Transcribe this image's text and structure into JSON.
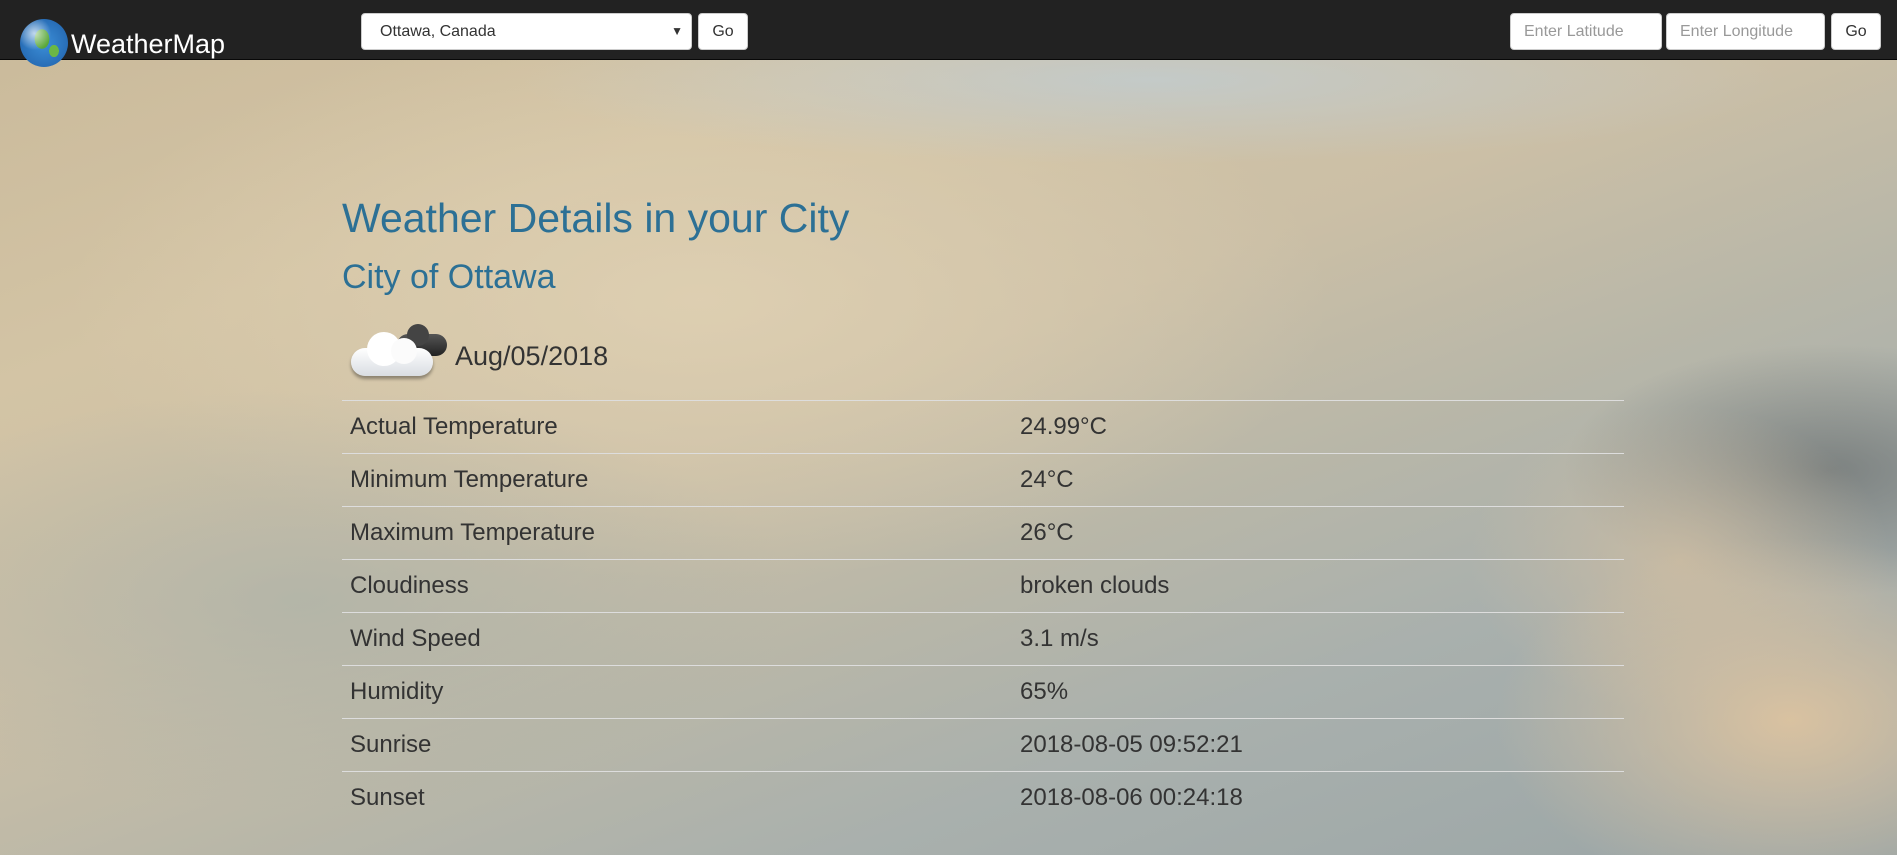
{
  "navbar": {
    "brand_name": "WeatherMap",
    "city_select_value": "Ottawa, Canada",
    "city_go_label": "Go",
    "latitude_placeholder": "Enter Latitude",
    "longitude_placeholder": "Enter Longitude",
    "coord_go_label": "Go",
    "icons": {
      "brand_icon": "globe-icon",
      "select_arrow": "chevron-down-icon"
    }
  },
  "main": {
    "title": "Weather Details in your City",
    "city_name": "City of Ottawa",
    "weather_icon": "broken-clouds-icon",
    "date": "Aug/05/2018",
    "details": [
      {
        "label": "Actual Temperature",
        "value": "24.99°C"
      },
      {
        "label": "Minimum Temperature",
        "value": "24°C"
      },
      {
        "label": "Maximum Temperature",
        "value": "26°C"
      },
      {
        "label": "Cloudiness",
        "value": "broken clouds"
      },
      {
        "label": "Wind Speed",
        "value": "3.1 m/s"
      },
      {
        "label": "Humidity",
        "value": "65%"
      },
      {
        "label": "Sunrise",
        "value": "2018-08-05 09:52:21"
      },
      {
        "label": "Sunset",
        "value": "2018-08-06 00:24:18"
      }
    ]
  },
  "colors": {
    "navbar_bg": "#222222",
    "heading": "#2c7095",
    "text": "#333333"
  }
}
